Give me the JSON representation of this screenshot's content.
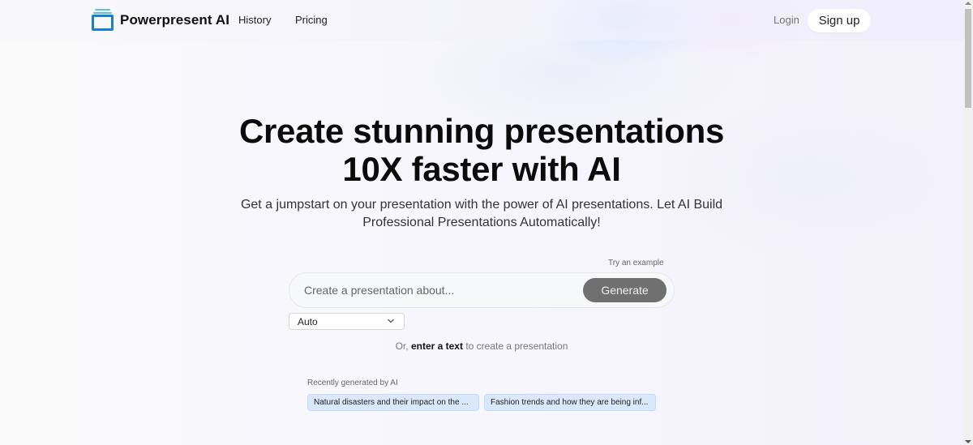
{
  "header": {
    "brand": "Powerpresent AI",
    "logo_icon": "stacked-slides-icon",
    "nav": [
      {
        "label": "History"
      },
      {
        "label": "Pricing"
      }
    ],
    "login_label": "Login",
    "signup_label": "Sign up"
  },
  "hero": {
    "title_line1": "Create stunning presentations",
    "title_line2": "10X faster with AI",
    "subtitle": "Get a jumpstart on your presentation with the power of AI presentations. Let AI Build Professional Presentations Automatically!"
  },
  "prompt": {
    "try_example_label": "Try an example",
    "placeholder": "Create a presentation about...",
    "value": "",
    "generate_label": "Generate",
    "mode_select": {
      "selected": "Auto",
      "icon": "chevron-down-icon"
    }
  },
  "alt_text": {
    "prefix": "Or,",
    "link": "enter a text",
    "suffix": "to create a presentation"
  },
  "recent": {
    "label": "Recently generated by AI",
    "items": [
      {
        "label": "Natural disasters and their impact on the ..."
      },
      {
        "label": "Fashion trends and how they are being inf..."
      }
    ]
  },
  "colors": {
    "logo_primary": "#1a7fd4",
    "logo_accent": "#5fc1e8",
    "generate_button": "#707070",
    "chip_bg": "#d9e8fb"
  }
}
